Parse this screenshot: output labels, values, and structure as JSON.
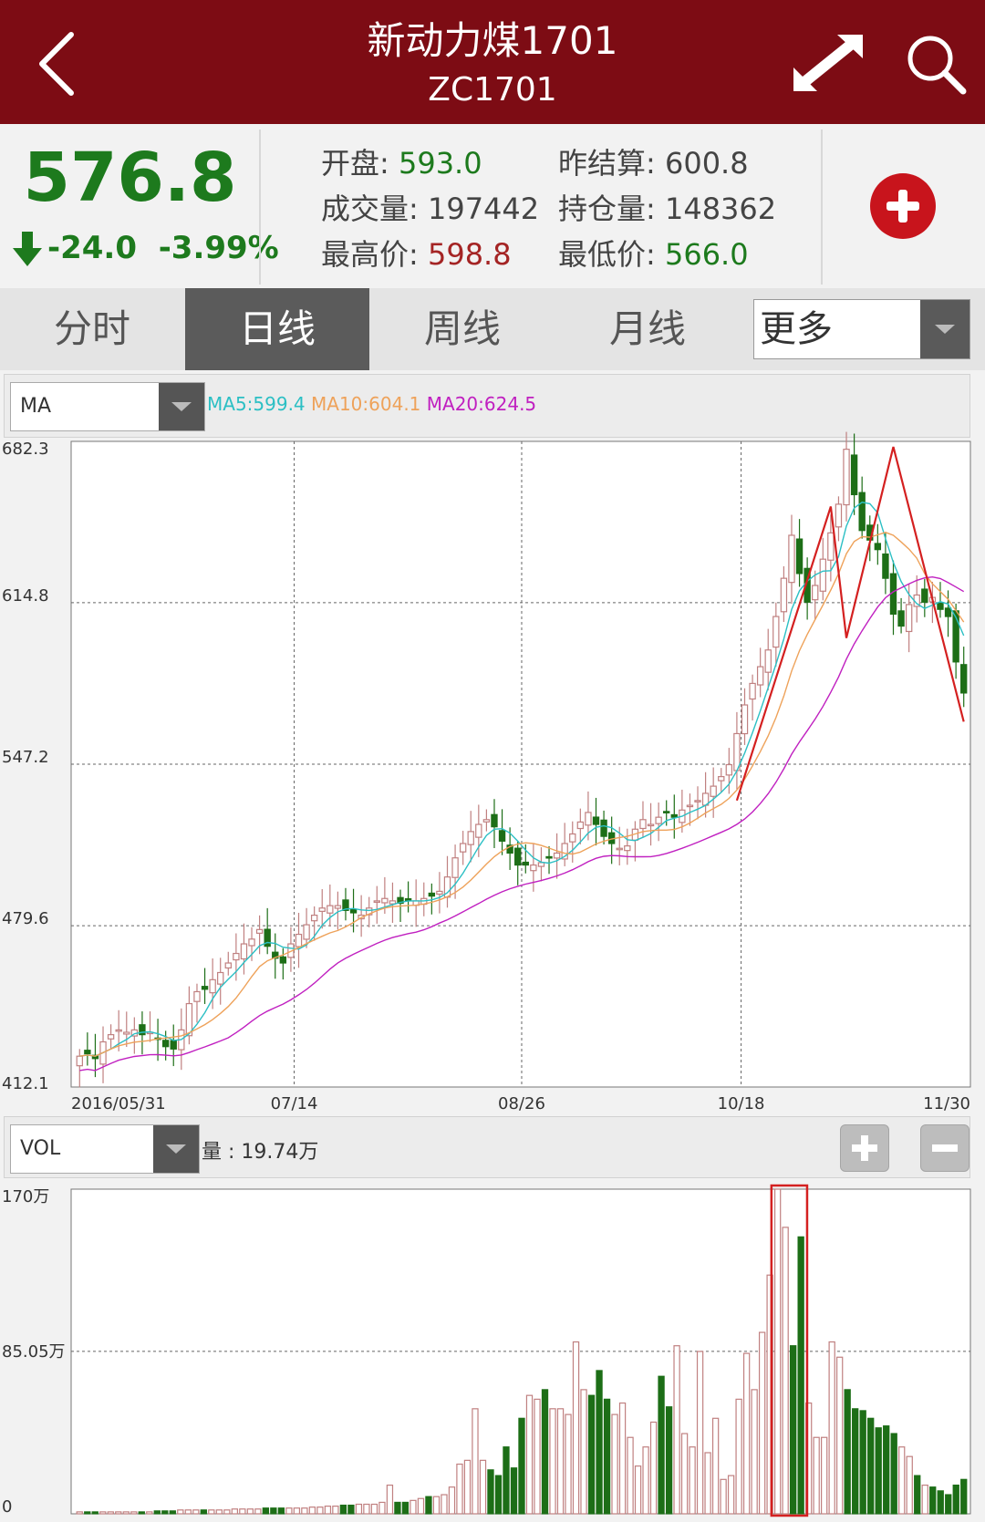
{
  "header": {
    "title": "新动力煤1701",
    "subtitle": "ZC1701"
  },
  "quote": {
    "price": "576.8",
    "change": "-24.0",
    "change_pct": "-3.99%",
    "open_label": "开盘:",
    "open": "593.0",
    "prev_settle_label": "昨结算:",
    "prev_settle": "600.8",
    "volume_label": "成交量:",
    "volume": "197442",
    "open_interest_label": "持仓量:",
    "open_interest": "148362",
    "high_label": "最高价:",
    "high": "598.8",
    "low_label": "最低价:",
    "low": "566.0"
  },
  "tabs": [
    {
      "label": "分时"
    },
    {
      "label": "日线",
      "active": true
    },
    {
      "label": "周线"
    },
    {
      "label": "月线"
    }
  ],
  "more_select": "更多",
  "indicator": {
    "select": "MA",
    "ma5": "MA5:599.4",
    "ma10": "MA10:604.1",
    "ma20": "MA20:624.5"
  },
  "vol_panel": {
    "select": "VOL",
    "label": "量 : 19.74万"
  },
  "colors": {
    "header_bg": "#7d0c14",
    "up": "#c08080",
    "down": "#1d6e17",
    "ma5": "#2bbfc4",
    "ma10": "#eea25a",
    "ma20": "#c020c0",
    "trend": "#d42020"
  },
  "chart_data": [
    {
      "type": "candlestick",
      "title": "ZC1701 日线",
      "ylim": [
        412.1,
        682.3
      ],
      "yticks": [
        "682.3",
        "614.8",
        "547.2",
        "479.6",
        "412.1"
      ],
      "xticks": [
        "2016/05/31",
        "07/14",
        "08/26",
        "10/18",
        "11/30"
      ],
      "grid": true,
      "close": [
        425,
        426,
        424,
        431,
        434,
        436,
        435,
        436,
        434,
        435,
        432,
        429,
        428,
        436,
        447,
        452,
        453,
        457,
        460,
        464,
        468,
        472,
        474,
        478,
        471,
        466,
        464,
        472,
        476,
        480,
        484,
        487,
        488,
        488,
        486,
        485,
        484,
        487,
        490,
        491,
        490,
        489,
        490,
        490,
        491,
        492,
        494,
        500,
        508,
        514,
        519,
        522,
        524,
        521,
        515,
        510,
        505,
        505,
        505,
        506,
        508,
        510,
        514,
        518,
        523,
        527,
        522,
        517,
        514,
        512,
        513,
        520,
        524,
        522,
        525,
        527,
        525,
        528,
        530,
        532,
        535,
        538,
        542,
        547,
        560,
        572,
        581,
        588,
        595,
        609,
        625,
        643,
        627,
        615,
        622,
        633,
        644,
        656,
        679,
        660,
        645,
        641,
        637,
        625,
        610,
        605,
        614,
        618,
        615,
        617,
        612,
        609,
        590,
        577
      ],
      "series": [
        {
          "name": "MA5",
          "color": "#2bbfc4"
        },
        {
          "name": "MA10",
          "color": "#eea25a"
        },
        {
          "name": "MA20",
          "color": "#c020c0"
        }
      ],
      "annotations": [
        "red zigzag trend lines"
      ]
    },
    {
      "type": "bar",
      "title": "VOL",
      "ylim": [
        0,
        170
      ],
      "yticks": [
        "170万",
        "85.05万",
        "0"
      ],
      "unit": "万",
      "values": [
        1,
        1,
        1,
        1,
        1,
        1,
        1,
        1,
        1,
        1,
        1.5,
        1.5,
        1.5,
        2,
        2,
        2,
        2,
        2,
        2,
        2,
        2.5,
        2.5,
        2.5,
        2.5,
        3,
        3,
        3,
        3,
        3,
        3,
        3.5,
        3.5,
        4,
        4,
        4.5,
        4.5,
        5,
        5,
        5,
        6,
        15,
        6,
        6,
        7,
        8,
        9,
        9,
        10,
        14,
        26,
        28,
        55,
        28,
        23,
        20,
        35,
        24,
        50,
        62,
        60,
        65,
        55,
        55,
        52,
        90,
        65,
        62,
        75,
        60,
        52,
        58,
        40,
        25,
        35,
        48,
        72,
        56,
        88,
        42,
        35,
        85,
        32,
        50,
        18,
        20,
        60,
        84,
        65,
        95,
        125,
        170,
        150,
        88,
        145,
        58,
        40,
        40,
        90,
        82,
        65,
        55,
        54,
        50,
        45,
        46,
        42,
        35,
        30,
        20,
        15,
        14,
        12,
        10,
        15,
        18
      ],
      "highlight": "red box around peak volume bars"
    }
  ]
}
